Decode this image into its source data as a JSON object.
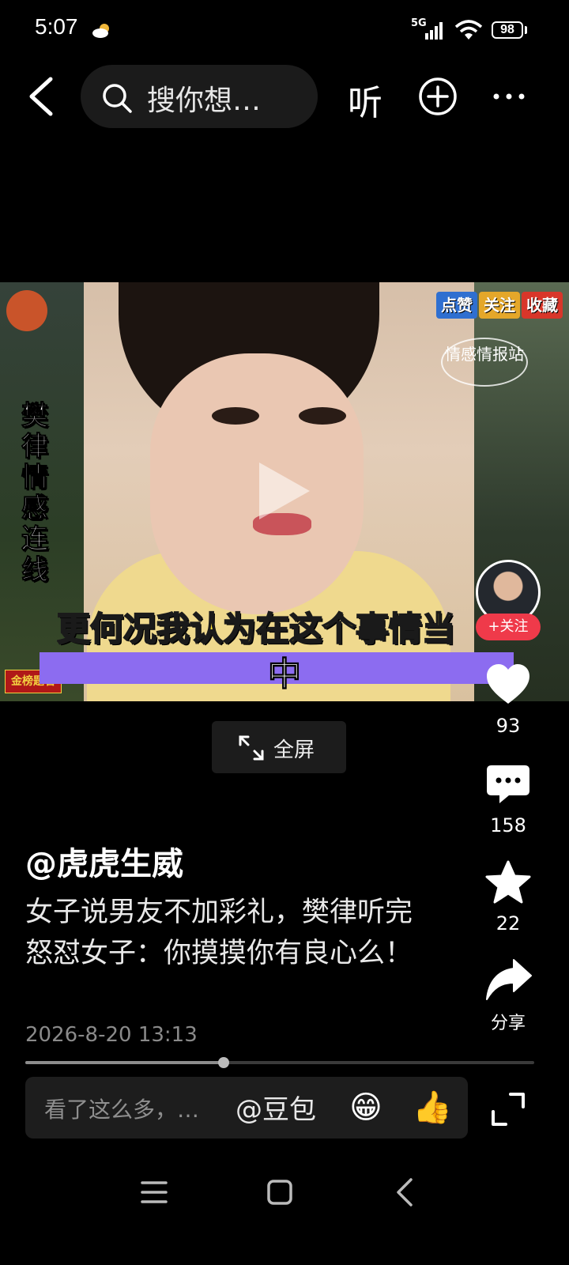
{
  "status_bar": {
    "time": "5:07",
    "weather_icon": "partly-cloudy-icon",
    "network": "5G",
    "battery": "98"
  },
  "top_bar": {
    "search_placeholder": "搜你想…",
    "listen_label": "听",
    "icons": [
      "back-icon",
      "search-icon",
      "plus-circle-icon",
      "more-icon"
    ]
  },
  "video": {
    "left_tag": "樊律情感连线",
    "top_right_chips": [
      "点赞",
      "关注",
      "收藏"
    ],
    "channel_stamp": "情感情报站",
    "caption_line1": "更何况我认为在这个事情当",
    "caption_line2": "中",
    "left_badge": "金榜题名"
  },
  "fullscreen": {
    "label": "全屏"
  },
  "rail": {
    "follow_label": "+关注",
    "likes": "93",
    "comments": "158",
    "favorites": "22",
    "share_label": "分享"
  },
  "post": {
    "author": "@虎虎生威",
    "description": "女子说男友不加彩礼，樊律听完怒怼女子：你摸摸你有良心么！",
    "date": "2026-8-20 13:13"
  },
  "progress": {
    "played_fraction": 0.39
  },
  "comment_bar": {
    "placeholder": "看了这么多，…",
    "mention_label": "@豆包",
    "emoji_1": "😁",
    "emoji_2": "👍"
  },
  "colors": {
    "background": "#000000",
    "follow_red": "#ef3a4a",
    "caption_yellow": "#ffe23a",
    "caption_bar": "#8c6cf0"
  }
}
